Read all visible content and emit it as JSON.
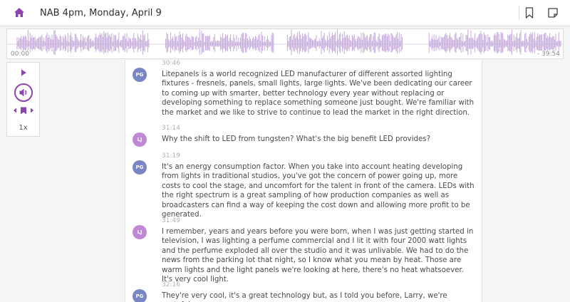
{
  "header": {
    "title": "NAB 4pm, Monday, April 9",
    "home_icon": "home-icon",
    "bookmark_icon": "bookmark-icon",
    "note_icon": "note-icon"
  },
  "player": {
    "time_start": "00:00",
    "time_end": "- 39:54",
    "speed": "1x",
    "played_fraction": 0.0
  },
  "colors": {
    "accent": "#8e44ad",
    "waveform": "#c5a8d8",
    "pg": "#7985c4",
    "lj": "#c089d6"
  },
  "transcript": [
    {
      "time": "30:46",
      "speaker": "PG",
      "text": "Litepanels is a world recognized LED manufacturer of different assorted lighting fixtures - fresnels, panels, small lights, large lights. We've been dedicating our career to coming up with smarter, better technology every year without replacing or developing something to replace something someone just bought. We're familiar with the market and we like to strive to continue to lead the market in the right direction."
    },
    {
      "time": "31:14",
      "speaker": "LJ",
      "text": "Why the shift to LED from tungsten? What's the big benefit LED provides?"
    },
    {
      "time": "31:19",
      "speaker": "PG",
      "text": "It's an energy consumption factor. When you take into account heating developing from lights in traditional studios, you've got the concern of power going up, more costs to cool the stage, and uncomfort for the talent in front of the camera. LEDs with the right spectrum is a great sampling of how production companies as well as broadcasters can find a way of keeping the cost down and allowing more profit to be generated."
    },
    {
      "time": "31:49",
      "speaker": "LJ",
      "text": "I remember, years and years before you were born, when I was just getting started in television, I was lighting a perfume commercial and I lit it with four 2000 watt lights and the perfume exploded all over the studio and it was unlivable. We had to do the news from the parking lot that night, so I know what you mean by heat. Those are warm lights and the light panels we're looking at here, there's no heat whatsoever. It's very cool light."
    },
    {
      "time": "32:16",
      "speaker": "PG",
      "text": "They're very cool, it's a great technology but, as I told you before, Larry, we're grateful"
    }
  ]
}
